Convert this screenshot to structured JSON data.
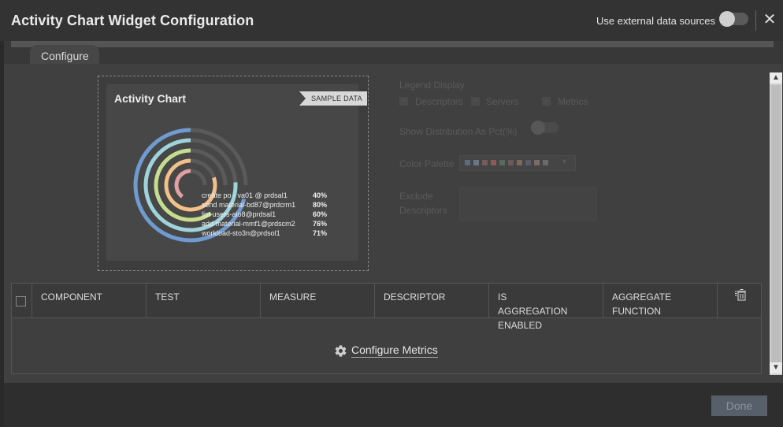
{
  "header": {
    "title": "Activity Chart Widget Configuration",
    "external_label": "Use external data sources",
    "close_glyph": "✕"
  },
  "tabs": [
    {
      "label": "Configure"
    }
  ],
  "preview": {
    "title": "Activity Chart",
    "badge": "SAMPLE DATA",
    "rings": [
      {
        "label": "create po - va01 @ prdsal1",
        "pct": "40%",
        "value": 0.4,
        "color": "#e3a0a0"
      },
      {
        "label": "send material-bd87@prdcrm1",
        "pct": "80%",
        "value": 0.8,
        "color": "#f4c08a"
      },
      {
        "label": "list users-alo8@prdsal1",
        "pct": "60%",
        "value": 0.6,
        "color": "#c6dc8e"
      },
      {
        "label": "add material-mmf1@prdscm2",
        "pct": "76%",
        "value": 0.76,
        "color": "#9fd3dc"
      },
      {
        "label": "workload-sto3n@prdsol1",
        "pct": "71%",
        "value": 0.71,
        "color": "#6f9bd1"
      }
    ]
  },
  "options": {
    "legend_display_label": "Legend Display",
    "legend_items": [
      "Descriptors",
      "Servers",
      "Metrics"
    ],
    "show_pct_label": "Show Distribution As Pct(%)",
    "color_palette_label": "Color Palette",
    "palette_colors": [
      "#5d6b7a",
      "#6a7686",
      "#7a5a5a",
      "#8a5a5a",
      "#5a6a5a",
      "#6a5a5a",
      "#7a6a5a",
      "#5a5a6a",
      "#7a6a6a",
      "#6a6a6a"
    ],
    "exclude_label_1": "Exclude",
    "exclude_label_2": "Descriptors"
  },
  "table": {
    "columns": [
      {
        "label": "COMPONENT"
      },
      {
        "label": "TEST"
      },
      {
        "label": "MEASURE"
      },
      {
        "label": "DESCRIPTOR"
      },
      {
        "label": "IS AGGREGATION ENABLED"
      },
      {
        "label": "AGGREGATE FUNCTION"
      }
    ],
    "configure_metrics": "Configure Metrics"
  },
  "footer": {
    "done_label": "Done"
  }
}
